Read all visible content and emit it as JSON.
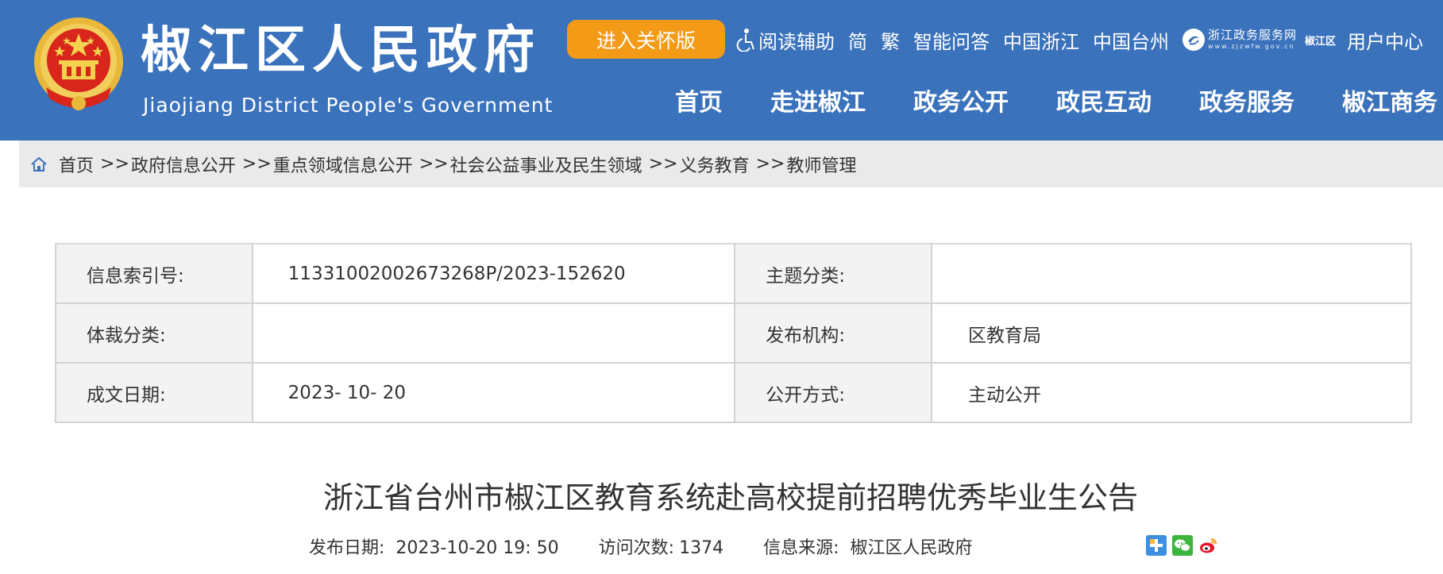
{
  "header": {
    "title": "椒江区人民政府",
    "subtitle": "Jiaojiang District People's Government",
    "care_button": "进入关怀版",
    "top_links": [
      "阅读辅助",
      "简",
      "繁",
      "智能问答",
      "中国浙江",
      "中国台州"
    ],
    "zwfw_name": "浙江政务服务网",
    "zwfw_url": "www.zjzwfw.gov.cn",
    "zwfw_area": "椒江区",
    "user_center": "用户中心",
    "nav": [
      "首页",
      "走进椒江",
      "政务公开",
      "政民互动",
      "政务服务",
      "椒江商务"
    ]
  },
  "breadcrumb": [
    "首页",
    "政府信息公开",
    "重点领域信息公开",
    "社会公益事业及民生领域",
    "义务教育",
    "教师管理"
  ],
  "breadcrumb_sep": ">>",
  "info": {
    "index_label": "信息索引号:",
    "index_value": "11331002002673268P/2023-152620",
    "topic_label": "主题分类:",
    "topic_value": "",
    "genre_label": "体裁分类:",
    "genre_value": "",
    "org_label": "发布机构:",
    "org_value": "区教育局",
    "date_label": "成文日期:",
    "date_value": "2023- 10- 20",
    "open_label": "公开方式:",
    "open_value": "主动公开"
  },
  "article": {
    "title": "浙江省台州市椒江区教育系统赴高校提前招聘优秀毕业生公告",
    "publish_label": "发布日期:",
    "publish_value": "2023-10-20 19: 50",
    "visits_label": "访问次数:",
    "visits_value": "1374",
    "source_label": "信息来源:",
    "source_value": "椒江区人民政府"
  },
  "colors": {
    "header_bg": "#3a72bc",
    "care_button": "#f39a17",
    "breadcrumb_bg": "#eaeaea",
    "table_label_bg": "#f3f3f3"
  },
  "icons": [
    "national-emblem-icon",
    "accessibility-icon",
    "zwfw-logo-icon",
    "home-icon",
    "share-plus-icon",
    "wechat-icon",
    "weibo-icon"
  ]
}
